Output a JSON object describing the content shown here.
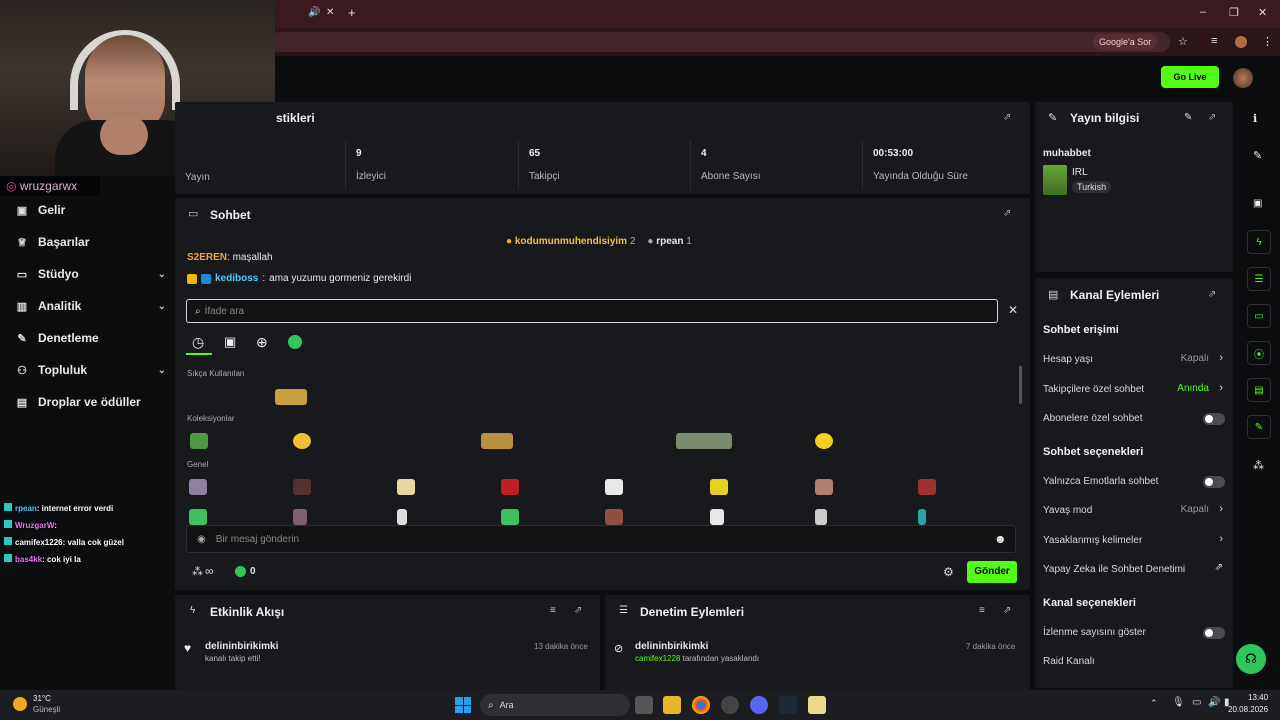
{
  "browser": {
    "google_button": "Google'a Sor",
    "window_controls": {
      "minimize": "‒",
      "maximize": "❐",
      "close": "✕"
    },
    "tab_icons": {
      "mute": "🔊",
      "close": "✕",
      "new_tab": "+"
    }
  },
  "header": {
    "go_live_label": "Go Live"
  },
  "streamer": {
    "handle": "wruzgarwx"
  },
  "sidebar": {
    "items": [
      {
        "label": "Gelir",
        "icon": "money-icon",
        "expandable": false
      },
      {
        "label": "Başarılar",
        "icon": "trophy-icon",
        "expandable": false
      },
      {
        "label": "Stüdyo",
        "icon": "studio-icon",
        "expandable": true
      },
      {
        "label": "Analitik",
        "icon": "chart-icon",
        "expandable": true
      },
      {
        "label": "Denetleme",
        "icon": "wrench-icon",
        "expandable": false
      },
      {
        "label": "Topluluk",
        "icon": "people-icon",
        "expandable": true
      },
      {
        "label": "Droplar ve ödüller",
        "icon": "gift-icon",
        "expandable": false
      }
    ]
  },
  "stats": {
    "title_partial": "stikleri",
    "cells": [
      {
        "value": "",
        "label": "Yayın"
      },
      {
        "value": "9",
        "label": "İzleyici"
      },
      {
        "value": "65",
        "label": "Takipçi"
      },
      {
        "value": "4",
        "label": "Abone Sayısı"
      },
      {
        "value": "00:53:00",
        "label": "Yayında Olduğu Süre"
      }
    ]
  },
  "chat": {
    "title": "Sohbet",
    "top_gifters": [
      {
        "name": "kodumunmuhendisiyim",
        "count": "2"
      },
      {
        "name": "rpean",
        "count": "1"
      }
    ],
    "messages": [
      {
        "user": "S2EREN",
        "text": "maşallah",
        "color": "#e8a24a"
      },
      {
        "user": "kediboss",
        "text": "ama yuzumu gormeniz gerekirdi",
        "color": "#53c8fc"
      }
    ],
    "emote_search_placeholder": "İfade ara",
    "emote_sections": [
      "Sıkça Kullanılan",
      "Koleksiyonlar",
      "Genel"
    ],
    "message_placeholder": "Bir mesaj gönderin",
    "infinity_label": "∞",
    "points_value": "0",
    "send_label": "Gönder"
  },
  "stream_info": {
    "title": "Yayın bilgisi",
    "stream_title": "muhabbet",
    "category": "IRL",
    "language": "Turkish"
  },
  "channel_actions": {
    "title": "Kanal Eylemleri",
    "sections": [
      {
        "heading": "Sohbet erişimi",
        "rows": [
          {
            "label": "Hesap yaşı",
            "value": "Kapalı",
            "type": "select"
          },
          {
            "label": "Takipçilere özel sohbet",
            "value": "Anında",
            "type": "select-green"
          },
          {
            "label": "Abonelere özel sohbet",
            "value": "",
            "type": "toggle"
          }
        ]
      },
      {
        "heading": "Sohbet seçenekleri",
        "rows": [
          {
            "label": "Yalnızca Emotlarla sohbet",
            "value": "",
            "type": "toggle"
          },
          {
            "label": "Yavaş mod",
            "value": "Kapalı",
            "type": "select"
          },
          {
            "label": "Yasaklanmış kelimeler",
            "value": "",
            "type": "link"
          },
          {
            "label": "Yapay Zeka ile Sohbet Denetimi",
            "value": "",
            "type": "external"
          }
        ]
      },
      {
        "heading": "Kanal seçenekleri",
        "rows": [
          {
            "label": "İzlenme sayısını göster",
            "value": "",
            "type": "toggle"
          },
          {
            "label": "Raid Kanalı",
            "value": "",
            "type": "none"
          }
        ]
      }
    ]
  },
  "activity": {
    "title": "Etkinlik Akışı",
    "items": [
      {
        "user": "delininbirikimki",
        "text": "kanalı takip etti!",
        "time": "13 dakika önce"
      }
    ]
  },
  "mod_actions": {
    "title": "Denetim Eylemleri",
    "items": [
      {
        "user": "delininbirikimki",
        "actor": "camifex1228",
        "text": "tarafından yasaklandı",
        "time": "7 dakika önce"
      }
    ]
  },
  "overlay_chat": [
    {
      "user": "rpean",
      "text": ": internet error verdi",
      "color": "#53c8fc"
    },
    {
      "user": "WruzgarW",
      "text": ":",
      "color": "#e07ae8"
    },
    {
      "user": "camifex1226",
      "text": ": valla cok güzel",
      "color": "#ffffff"
    },
    {
      "user": "bas4kk",
      "text": ": cok iyi la",
      "color": "#e07ae8"
    }
  ],
  "taskbar": {
    "weather_temp": "31°C",
    "weather_desc": "Güneşli",
    "search_label": "Ara",
    "time": "13:40",
    "date": "20.08.2026"
  }
}
